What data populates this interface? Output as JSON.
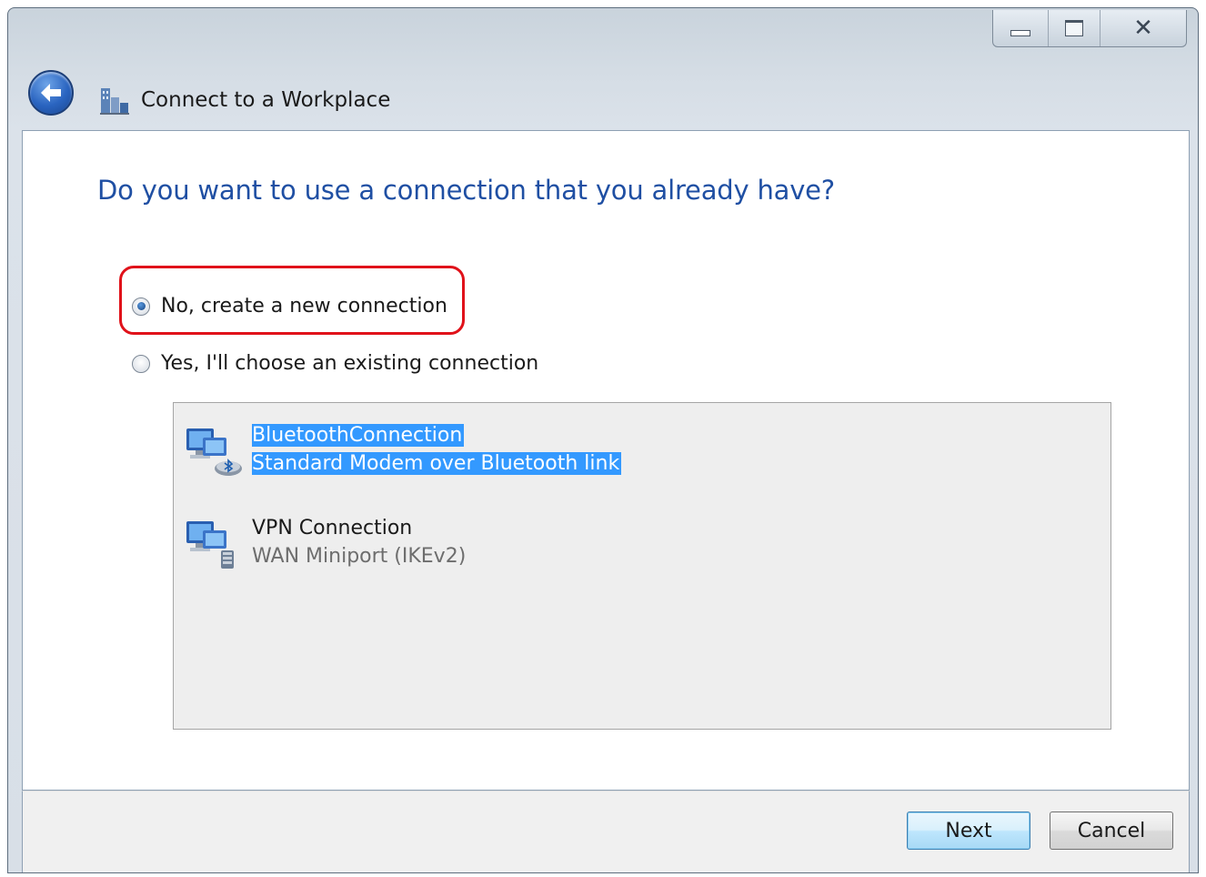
{
  "window": {
    "title": "Connect to a Workplace",
    "controls": {
      "minimize": "minimize",
      "maximize": "maximize",
      "close": "✕"
    }
  },
  "main": {
    "heading": "Do you want to use a connection that you already have?",
    "options": [
      {
        "label": "No, create a new connection",
        "selected": true
      },
      {
        "label": "Yes, I'll choose an existing connection",
        "selected": false
      }
    ],
    "connections": [
      {
        "name": "BluetoothConnection",
        "device": "Standard Modem over Bluetooth link",
        "icon": "bluetooth-modem-connection-icon",
        "selected": true
      },
      {
        "name": "VPN Connection",
        "device": "WAN Miniport (IKEv2)",
        "icon": "vpn-connection-icon",
        "selected": false
      }
    ]
  },
  "footer": {
    "next_label": "Next",
    "cancel_label": "Cancel"
  },
  "colors": {
    "heading": "#1f4fa3",
    "selection": "#3399ff",
    "highlight_box": "#e0121a"
  }
}
